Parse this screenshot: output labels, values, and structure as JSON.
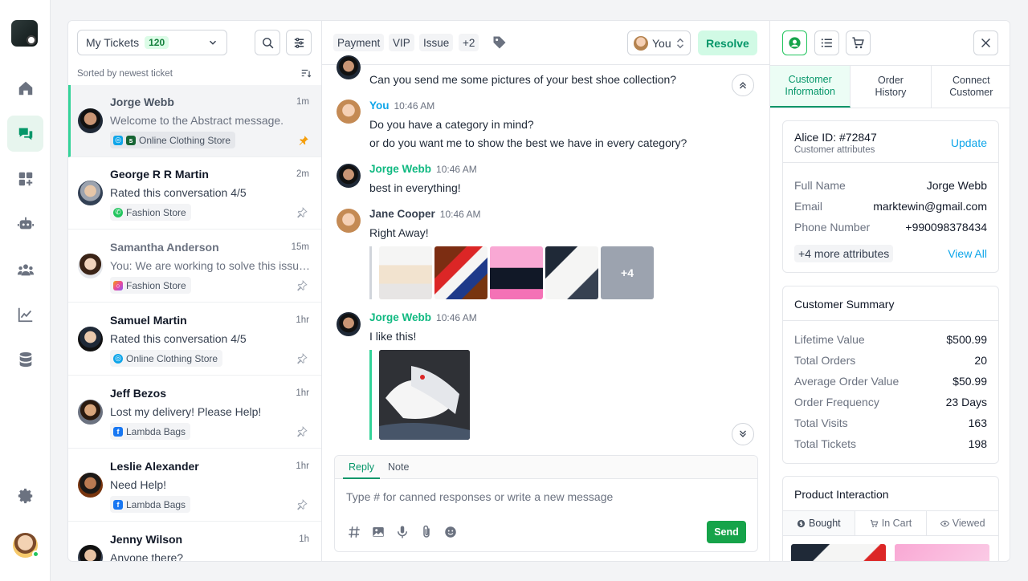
{
  "nav": {
    "items": [
      {
        "name": "home-icon"
      },
      {
        "name": "chat-icon",
        "active": true
      },
      {
        "name": "apps-icon"
      },
      {
        "name": "bot-icon"
      },
      {
        "name": "team-icon"
      },
      {
        "name": "analytics-icon"
      },
      {
        "name": "database-icon"
      }
    ],
    "settings_icon": "gear-icon"
  },
  "tickets": {
    "filter_label": "My Tickets",
    "filter_count": "120",
    "sorted_label": "Sorted by newest ticket",
    "items": [
      {
        "name": "Jorge Webb",
        "time": "1m",
        "message": "Welcome to the Abstract message.",
        "source": "Online Clothing Store",
        "active": true,
        "pinned": true
      },
      {
        "name": "George R R Martin",
        "time": "2m",
        "message": "Rated this conversation 4/5",
        "source": "Fashion Store"
      },
      {
        "name": "Samantha Anderson",
        "time": "15m",
        "message": "You: We are working to solve this issue...",
        "source": "Fashion Store",
        "muted": true
      },
      {
        "name": "Samuel Martin",
        "time": "1hr",
        "message": "Rated this conversation 4/5",
        "source": "Online Clothing Store"
      },
      {
        "name": "Jeff Bezos",
        "time": "1hr",
        "message": "Lost my delivery! Please Help!",
        "source": "Lambda Bags"
      },
      {
        "name": "Leslie Alexander",
        "time": "1hr",
        "message": "Need Help!",
        "source": "Lambda Bags"
      },
      {
        "name": "Jenny Wilson",
        "time": "1h",
        "message": "Anyone there?",
        "source": ""
      }
    ]
  },
  "chat": {
    "tags": [
      "Payment",
      "VIP",
      "Issue",
      "+2"
    ],
    "assignee": "You",
    "resolve_label": "Resolve",
    "messages": [
      {
        "author": "",
        "time": "",
        "lines": [
          "Can you send me some pictures of your best shoe collection?"
        ]
      },
      {
        "author": "You",
        "time": "10:46 AM",
        "lines": [
          "Do you have a category in mind?",
          "or do you want me to show the best we have in every category?"
        ]
      },
      {
        "author": "Jorge Webb",
        "time": "10:46 AM",
        "lines": [
          "best in everything!"
        ]
      },
      {
        "author": "Jane Cooper",
        "time": "10:46 AM",
        "lines": [
          "Right Away!"
        ],
        "more_images": "+4"
      },
      {
        "author": "Jorge Webb",
        "time": "10:46 AM",
        "lines": [
          "I like this!"
        ]
      }
    ],
    "composer": {
      "tab_reply": "Reply",
      "tab_note": "Note",
      "placeholder": "Type # for canned responses or write a new message",
      "send_label": "Send"
    }
  },
  "side": {
    "tabs": [
      "Customer\nInformation",
      "Order\nHistory",
      "Connect\nCustomer"
    ],
    "customer": {
      "id": "Alice ID: #72847",
      "subtitle": "Customer attributes",
      "update_label": "Update",
      "attributes": [
        {
          "k": "Full Name",
          "v": "Jorge Webb"
        },
        {
          "k": "Email",
          "v": "marktewin@gmail.com"
        },
        {
          "k": "Phone Number",
          "v": "+990098378434"
        }
      ],
      "more_attributes": "+4 more attributes",
      "view_all": "View All"
    },
    "summary": {
      "title": "Customer Summary",
      "rows": [
        {
          "k": "Lifetime Value",
          "v": "$500.99"
        },
        {
          "k": "Total Orders",
          "v": "20"
        },
        {
          "k": "Average Order Value",
          "v": "$50.99"
        },
        {
          "k": "Order Frequency",
          "v": "23 Days"
        },
        {
          "k": "Total Visits",
          "v": "163"
        },
        {
          "k": "Total Tickets",
          "v": "198"
        }
      ]
    },
    "products": {
      "title": "Product Interaction",
      "tabs": [
        "Bought",
        "In Cart",
        "Viewed"
      ]
    }
  },
  "colors": {
    "accent": "#059669",
    "link": "#0ea5e9",
    "resolve_bg": "#d1fae5"
  }
}
